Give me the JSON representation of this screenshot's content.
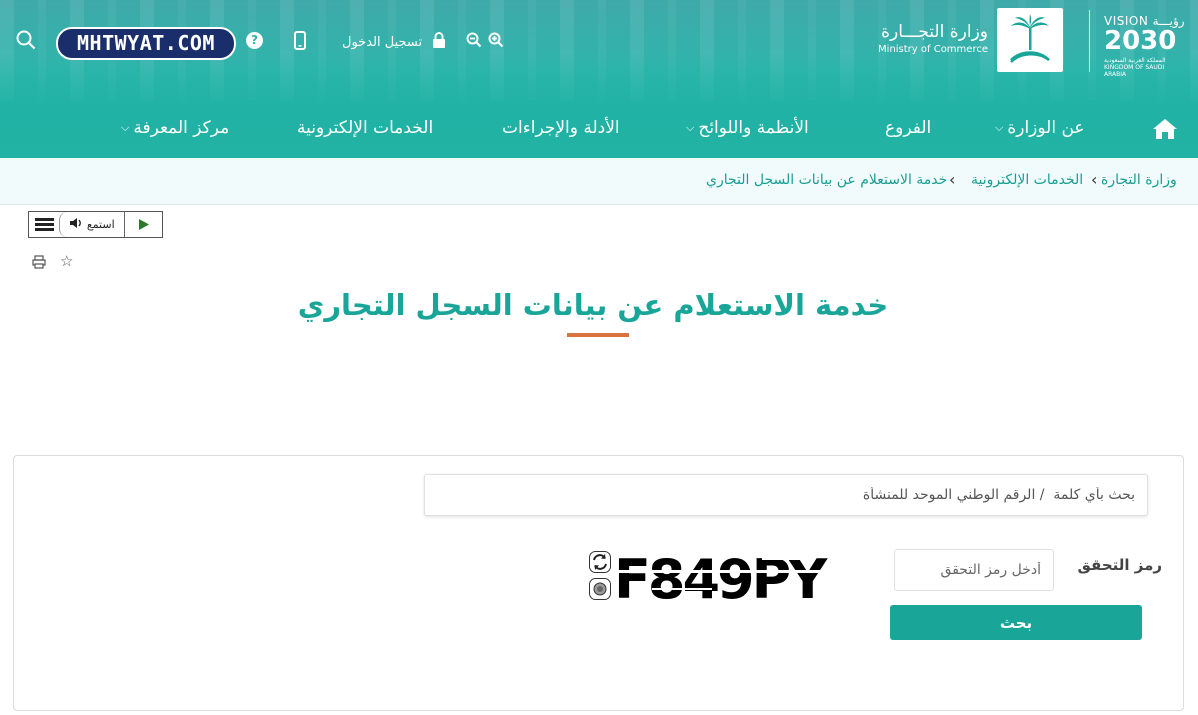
{
  "header": {
    "vision": {
      "top": "VISION رؤيـــة",
      "number": "2030",
      "sub": "المملكة العربية السعودية KINGDOM OF SAUDI ARABIA"
    },
    "ministry_ar": "وزارة التجـــارة",
    "ministry_en": "Ministry of Commerce",
    "login_label": "تسجيل الدخول",
    "help_label": "?",
    "watermark": "MHTWYAT.COM",
    "colors": {
      "primary": "#1aa599",
      "accent": "#d9733f",
      "header": "#2fb5ac"
    }
  },
  "nav": {
    "items": [
      {
        "label": "عن الوزارة",
        "has_dropdown": true
      },
      {
        "label": "الفروع",
        "has_dropdown": false
      },
      {
        "label": "الأنظمة واللوائح",
        "has_dropdown": true
      },
      {
        "label": "الأدلة والإجراءات",
        "has_dropdown": false
      },
      {
        "label": "الخدمات الإلكترونية",
        "has_dropdown": false
      },
      {
        "label": "مركز المعرفة",
        "has_dropdown": true
      }
    ]
  },
  "breadcrumb": {
    "items": [
      "وزارة التجارة",
      "الخدمات الإلكترونية",
      "خدمة الاستعلام عن بيانات السجل التجاري"
    ]
  },
  "tools": {
    "listen_label": "استمع"
  },
  "page": {
    "title": "خدمة الاستعلام عن بيانات السجل التجاري"
  },
  "form": {
    "search_placeholder": "بحث بأي كلمة  / الرقم الوطني الموحد للمنشأة",
    "captcha_label": "رمز التحقق",
    "captcha_placeholder": "أدخل رمز التحقق",
    "captcha_text": "F849PY",
    "submit_label": "بحث"
  },
  "icons": [
    "home-icon",
    "search-icon",
    "help-icon",
    "mobile-icon",
    "lock-icon",
    "zoom-in-icon",
    "zoom-out-icon",
    "menu-icon",
    "speaker-icon",
    "play-icon",
    "print-icon",
    "star-icon",
    "refresh-icon",
    "audio-icon"
  ]
}
